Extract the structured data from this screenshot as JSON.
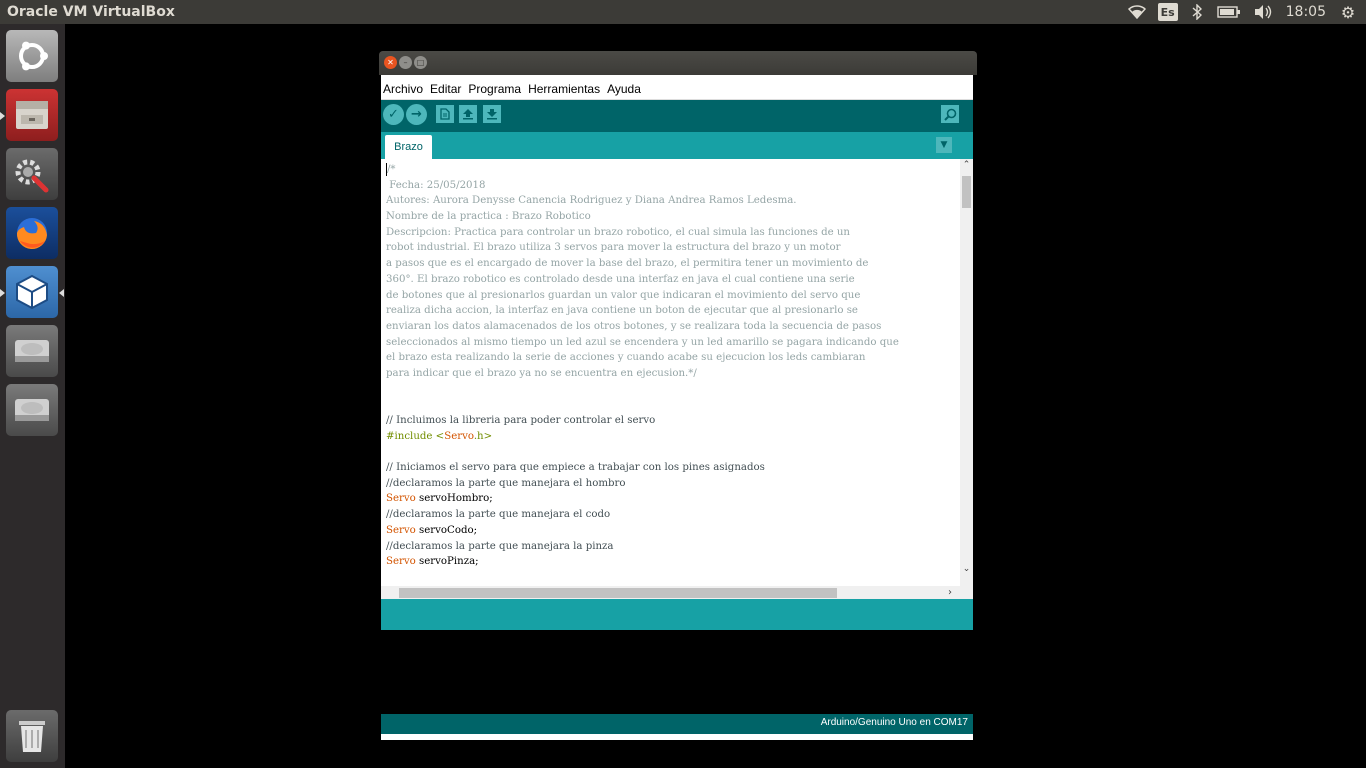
{
  "top_panel": {
    "app_title": "Oracle VM VirtualBox",
    "keyboard_layout": "Es",
    "clock": "18:05"
  },
  "launcher": {
    "items": [
      "ubuntu-dash",
      "files",
      "system-settings",
      "firefox",
      "virtualbox",
      "drive-1",
      "drive-2",
      "trash"
    ],
    "active": "virtualbox"
  },
  "arduino": {
    "menu": [
      "Archivo",
      "Editar",
      "Programa",
      "Herramientas",
      "Ayuda"
    ],
    "tab": "Brazo",
    "footer": "Arduino/Genuino Uno en COM17",
    "code_lines": [
      {
        "cls": "c-comment",
        "text": "/*"
      },
      {
        "cls": "c-comment",
        "text": " Fecha: 25/05/2018"
      },
      {
        "cls": "c-comment",
        "text": "Autores: Aurora Denysse Canencia Rodriguez y Diana Andrea Ramos Ledesma."
      },
      {
        "cls": "c-comment",
        "text": "Nombre de la practica : Brazo Robotico"
      },
      {
        "cls": "c-comment",
        "text": "Descripcion: Practica para controlar un brazo robotico, el cual simula las funciones de un"
      },
      {
        "cls": "c-comment",
        "text": "robot industrial. El brazo utiliza 3 servos para mover la estructura del brazo y un motor"
      },
      {
        "cls": "c-comment",
        "text": "a pasos que es el encargado de mover la base del brazo, el permitira tener un movimiento de"
      },
      {
        "cls": "c-comment",
        "text": "360°. El brazo robotico es controlado desde una interfaz en java el cual contiene una serie"
      },
      {
        "cls": "c-comment",
        "text": "de botones que al presionarlos guardan un valor que indicaran el movimiento del servo que"
      },
      {
        "cls": "c-comment",
        "text": "realiza dicha accion, la interfaz en java contiene un boton de ejecutar que al presionarlo se"
      },
      {
        "cls": "c-comment",
        "text": "enviaran los datos alamacenados de los otros botones, y se realizara toda la secuencia de pasos"
      },
      {
        "cls": "c-comment",
        "text": "seleccionados al mismo tiempo un led azul se encendera y un led amarillo se pagara indicando que"
      },
      {
        "cls": "c-comment",
        "text": "el brazo esta realizando la serie de acciones y cuando acabe su ejecucion los leds cambiaran"
      },
      {
        "cls": "c-comment",
        "text": "para indicar que el brazo ya no se encuentra en ejecusion.*/"
      },
      {
        "cls": "c-plain",
        "text": ""
      },
      {
        "cls": "c-plain",
        "text": ""
      },
      {
        "cls": "c-line",
        "text": "// Incluimos la libreria para poder controlar el servo"
      },
      {
        "cls": "include",
        "pre": "#include <",
        "kw": "Servo",
        "post": ".h>"
      },
      {
        "cls": "c-plain",
        "text": ""
      },
      {
        "cls": "c-line",
        "text": "// Iniciamos el servo para que empiece a trabajar con los pines asignados"
      },
      {
        "cls": "c-line",
        "text": "//declaramos la parte que manejara el hombro"
      },
      {
        "cls": "decl",
        "kw": "Servo",
        "rest": " servoHombro;"
      },
      {
        "cls": "c-line",
        "text": "//declaramos la parte que manejara el codo"
      },
      {
        "cls": "decl",
        "kw": "Servo",
        "rest": " servoCodo;"
      },
      {
        "cls": "c-line",
        "text": "//declaramos la parte que manejara la pinza"
      },
      {
        "cls": "decl",
        "kw": "Servo",
        "rest": " servoPinza;"
      }
    ]
  }
}
